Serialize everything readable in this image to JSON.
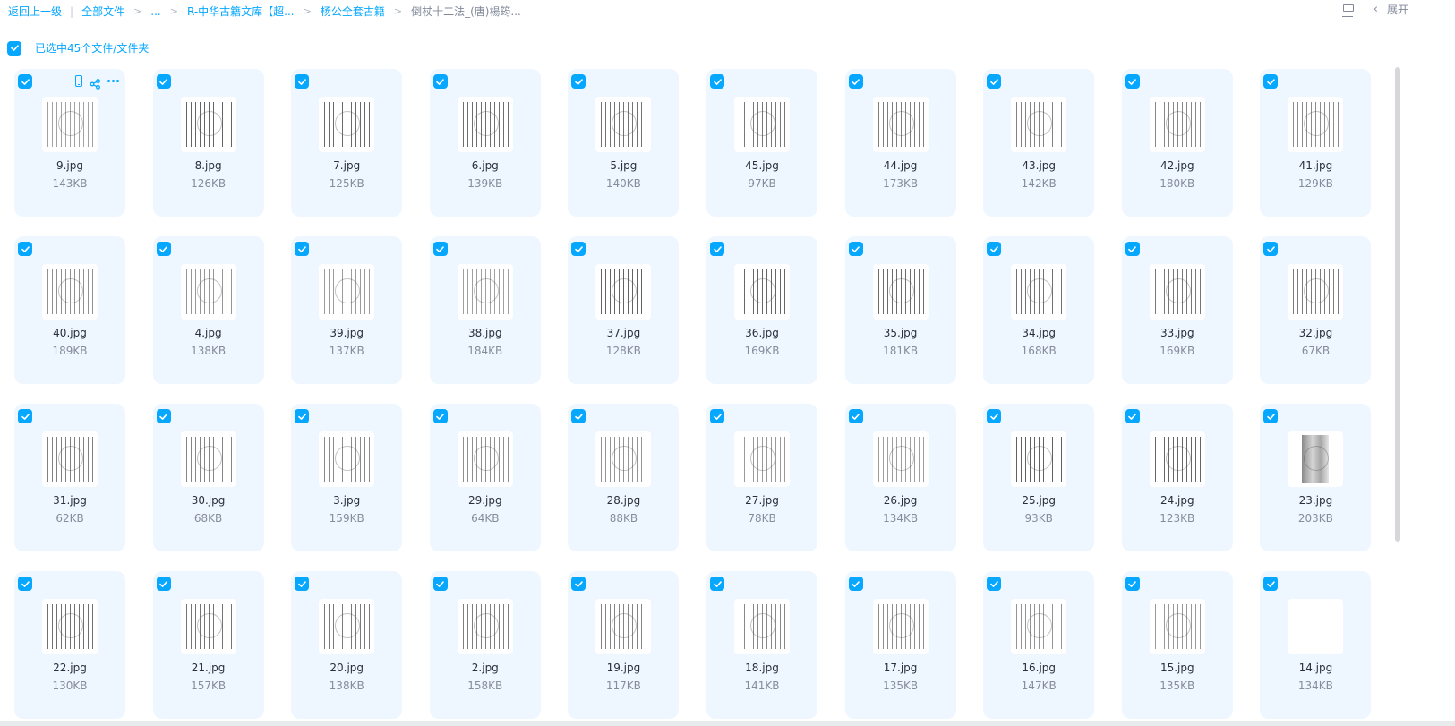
{
  "breadcrumb": {
    "back": "返回上一级",
    "separator_bar": "|",
    "items": [
      "全部文件",
      "...",
      "R-中华古籍文库【超...",
      "杨公全套古籍"
    ],
    "current": "倒杖十二法_(唐)楊筠...",
    "separator": ">"
  },
  "toolbar": {
    "expand_label": "展开",
    "list_view_icon": "list-view-icon",
    "chevron_icon": "chevron-left-icon",
    "chevron_glyph": "‹"
  },
  "selection": {
    "label": "已选中45个文件/文件夹",
    "checked": true
  },
  "files": [
    {
      "name": "9.jpg",
      "size": "143KB"
    },
    {
      "name": "8.jpg",
      "size": "126KB"
    },
    {
      "name": "7.jpg",
      "size": "125KB"
    },
    {
      "name": "6.jpg",
      "size": "139KB"
    },
    {
      "name": "5.jpg",
      "size": "140KB"
    },
    {
      "name": "45.jpg",
      "size": "97KB"
    },
    {
      "name": "44.jpg",
      "size": "173KB"
    },
    {
      "name": "43.jpg",
      "size": "142KB"
    },
    {
      "name": "42.jpg",
      "size": "180KB"
    },
    {
      "name": "41.jpg",
      "size": "129KB"
    },
    {
      "name": "40.jpg",
      "size": "189KB"
    },
    {
      "name": "4.jpg",
      "size": "138KB"
    },
    {
      "name": "39.jpg",
      "size": "137KB"
    },
    {
      "name": "38.jpg",
      "size": "184KB"
    },
    {
      "name": "37.jpg",
      "size": "128KB"
    },
    {
      "name": "36.jpg",
      "size": "169KB"
    },
    {
      "name": "35.jpg",
      "size": "181KB"
    },
    {
      "name": "34.jpg",
      "size": "168KB"
    },
    {
      "name": "33.jpg",
      "size": "169KB"
    },
    {
      "name": "32.jpg",
      "size": "67KB"
    },
    {
      "name": "31.jpg",
      "size": "62KB"
    },
    {
      "name": "30.jpg",
      "size": "68KB"
    },
    {
      "name": "3.jpg",
      "size": "159KB"
    },
    {
      "name": "29.jpg",
      "size": "64KB"
    },
    {
      "name": "28.jpg",
      "size": "88KB"
    },
    {
      "name": "27.jpg",
      "size": "78KB"
    },
    {
      "name": "26.jpg",
      "size": "134KB"
    },
    {
      "name": "25.jpg",
      "size": "93KB"
    },
    {
      "name": "24.jpg",
      "size": "123KB"
    },
    {
      "name": "23.jpg",
      "size": "203KB"
    },
    {
      "name": "22.jpg",
      "size": "130KB"
    },
    {
      "name": "21.jpg",
      "size": "157KB"
    },
    {
      "name": "20.jpg",
      "size": "138KB"
    },
    {
      "name": "2.jpg",
      "size": "158KB"
    },
    {
      "name": "19.jpg",
      "size": "117KB"
    },
    {
      "name": "18.jpg",
      "size": "141KB"
    },
    {
      "name": "17.jpg",
      "size": "135KB"
    },
    {
      "name": "16.jpg",
      "size": "147KB"
    },
    {
      "name": "15.jpg",
      "size": "135KB"
    },
    {
      "name": "14.jpg",
      "size": "134KB"
    }
  ],
  "hover_card_actions": [
    "phone-icon",
    "share-icon",
    "more-icon"
  ],
  "colors": {
    "accent": "#06a7ff",
    "card_bg": "#eef7ff",
    "muted_text": "#878c9c"
  }
}
